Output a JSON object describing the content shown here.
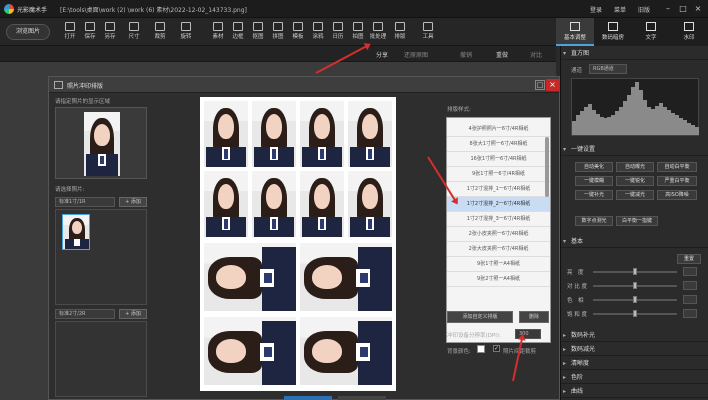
{
  "app": {
    "title": "光影魔术手",
    "path": "[E:\\tools\\桌面\\work (2) \\work (6) 素材\\2022-12-02_143733.png]",
    "top_right": [
      "登录",
      "菜单",
      "旧版"
    ]
  },
  "toolbar": {
    "open_label": "浏览图片",
    "tools": [
      "打开",
      "保存",
      "另存",
      "尺寸",
      "裁剪",
      "旋转",
      "素材",
      "边框",
      "抠图",
      "拼图",
      "模板",
      "涂鸦",
      "日历",
      "拍图",
      "批处理",
      "排版",
      "工具"
    ]
  },
  "right_tabs": [
    {
      "label": "基本调整",
      "icon": "sliders-icon"
    },
    {
      "label": "数码暗房",
      "icon": "camera-icon"
    },
    {
      "label": "文字",
      "icon": "text-icon"
    },
    {
      "label": "水印",
      "icon": "watermark-icon"
    }
  ],
  "subbar": {
    "share": "分享",
    "restore": "还原原图",
    "undo": "撤销",
    "redo": "重做",
    "compare": "对比"
  },
  "dialog": {
    "title": "照片冲印排版",
    "drag_hint": "请指定照片的显示区域",
    "add_photo_label": "请选择照片:",
    "size1_select": "标准1寸/1R",
    "size2_select": "标准2寸/2R",
    "add_btn": "+ 添加",
    "layout_label": "排版样式:",
    "layout_items": [
      "4张护照照片一6寸/4R相纸",
      "8张大1寸照一6寸/4R相纸",
      "16张1寸照一6寸/4R相纸",
      "9张1寸照一6寸/4R相纸",
      "1寸2寸混排_1一6寸/4R相纸",
      "1寸2寸混排_2一6寸/4R相纸",
      "1寸2寸混排_3一6寸/4R相纸",
      "2张小皮夹照一6寸/4R相纸",
      "2张大皮夹照一6寸/4R相纸",
      "9张1寸照一A4相纸",
      "9张2寸照一A4相纸"
    ],
    "selected_index": 5,
    "add_custom_btn": "添加自定义排版",
    "delete_btn": "删除",
    "dpi_label": "冲印设备分辨率(DPI):",
    "dpi_value": "300",
    "bg_label": "背景颜色:",
    "cut_label": "照片间距裁剪"
  },
  "histogram": {
    "title": "直方图",
    "channel_label": "通道",
    "channel_value": "RGB通道",
    "bars": [
      0.25,
      0.35,
      0.42,
      0.5,
      0.55,
      0.45,
      0.38,
      0.33,
      0.3,
      0.32,
      0.36,
      0.42,
      0.5,
      0.6,
      0.72,
      0.85,
      0.95,
      0.8,
      0.62,
      0.5,
      0.46,
      0.52,
      0.58,
      0.5,
      0.44,
      0.4,
      0.36,
      0.3,
      0.26,
      0.22,
      0.18,
      0.14
    ]
  },
  "panel": {
    "oneclick_title": "一键设置",
    "oneclick_buttons": [
      "自动美化",
      "自动曝光",
      "自动白平衡",
      "一键模糊",
      "一键锐化",
      "严重白平衡",
      "一键补光",
      "一键减光",
      "高ISO降噪",
      "数字点测光",
      "白平衡一指键"
    ],
    "basic_title": "基本",
    "reset_btn": "重置",
    "sliders": [
      {
        "label": "亮　度",
        "value": 0.5
      },
      {
        "label": "对 比 度",
        "value": 0.5
      },
      {
        "label": "色　相",
        "value": 0.5
      },
      {
        "label": "饱 和 度",
        "value": 0.5
      }
    ],
    "sections": [
      "数码补光",
      "数码减光",
      "清晰度",
      "色阶",
      "曲线"
    ]
  }
}
